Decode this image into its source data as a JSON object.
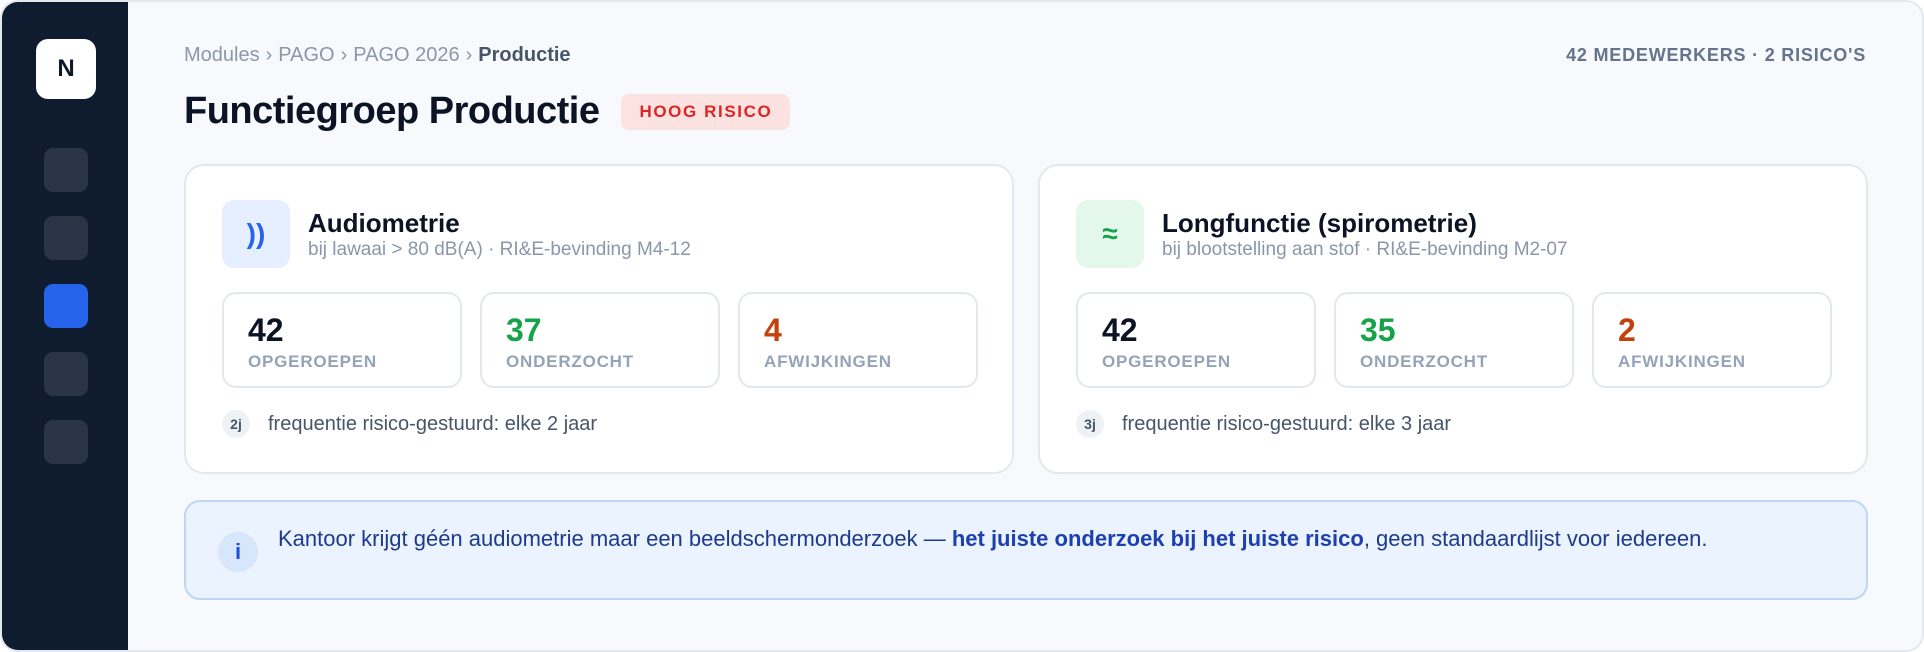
{
  "sidebar": {
    "logo": "N",
    "items": [
      {
        "name": "nav-item-1",
        "active": false
      },
      {
        "name": "nav-item-2",
        "active": false
      },
      {
        "name": "nav-item-3",
        "active": true
      },
      {
        "name": "nav-item-4",
        "active": false
      },
      {
        "name": "nav-item-5",
        "active": false
      }
    ]
  },
  "breadcrumb": {
    "items": [
      "Modules",
      "PAGO",
      "PAGO 2026"
    ],
    "current": "Productie",
    "separator": "›"
  },
  "summary": "42 MEDEWERKERS · 2 RISICO'S",
  "page": {
    "title": "Functiegroep Productie",
    "badge": "HOOG RISICO"
  },
  "cards": [
    {
      "icon": "sound-waves-icon",
      "icon_glyph": "))",
      "title": "Audiometrie",
      "subtitle": "bij lawaai > 80 dB(A) · RI&E-bevinding M4-12",
      "stats": [
        {
          "value": "42",
          "label": "OPGEROEPEN"
        },
        {
          "value": "37",
          "label": "ONDERZOCHT"
        },
        {
          "value": "4",
          "label": "AFWIJKINGEN"
        }
      ],
      "frequency_badge": "2j",
      "frequency_text": "frequentie risico-gestuurd: elke 2 jaar"
    },
    {
      "icon": "airflow-icon",
      "icon_glyph": "≈",
      "title": "Longfunctie (spirometrie)",
      "subtitle": "bij blootstelling aan stof · RI&E-bevinding M2-07",
      "stats": [
        {
          "value": "42",
          "label": "OPGEROEPEN"
        },
        {
          "value": "35",
          "label": "ONDERZOCHT"
        },
        {
          "value": "2",
          "label": "AFWIJKINGEN"
        }
      ],
      "frequency_badge": "3j",
      "frequency_text": "frequentie risico-gestuurd: elke 3 jaar"
    }
  ],
  "info": {
    "icon_glyph": "i",
    "text_before": "Kantoor krijgt géén audiometrie maar een beeldschermonderzoek — ",
    "text_bold": "het juiste onderzoek bij het juiste risico",
    "text_after": ", geen standaardlijst voor iedereen."
  },
  "colors": {
    "sidebar": "#0f1b2e",
    "accent": "#2563eb",
    "risk_red": "#dc2626",
    "success_green": "#16a34a",
    "warning_orange": "#c2410c"
  }
}
